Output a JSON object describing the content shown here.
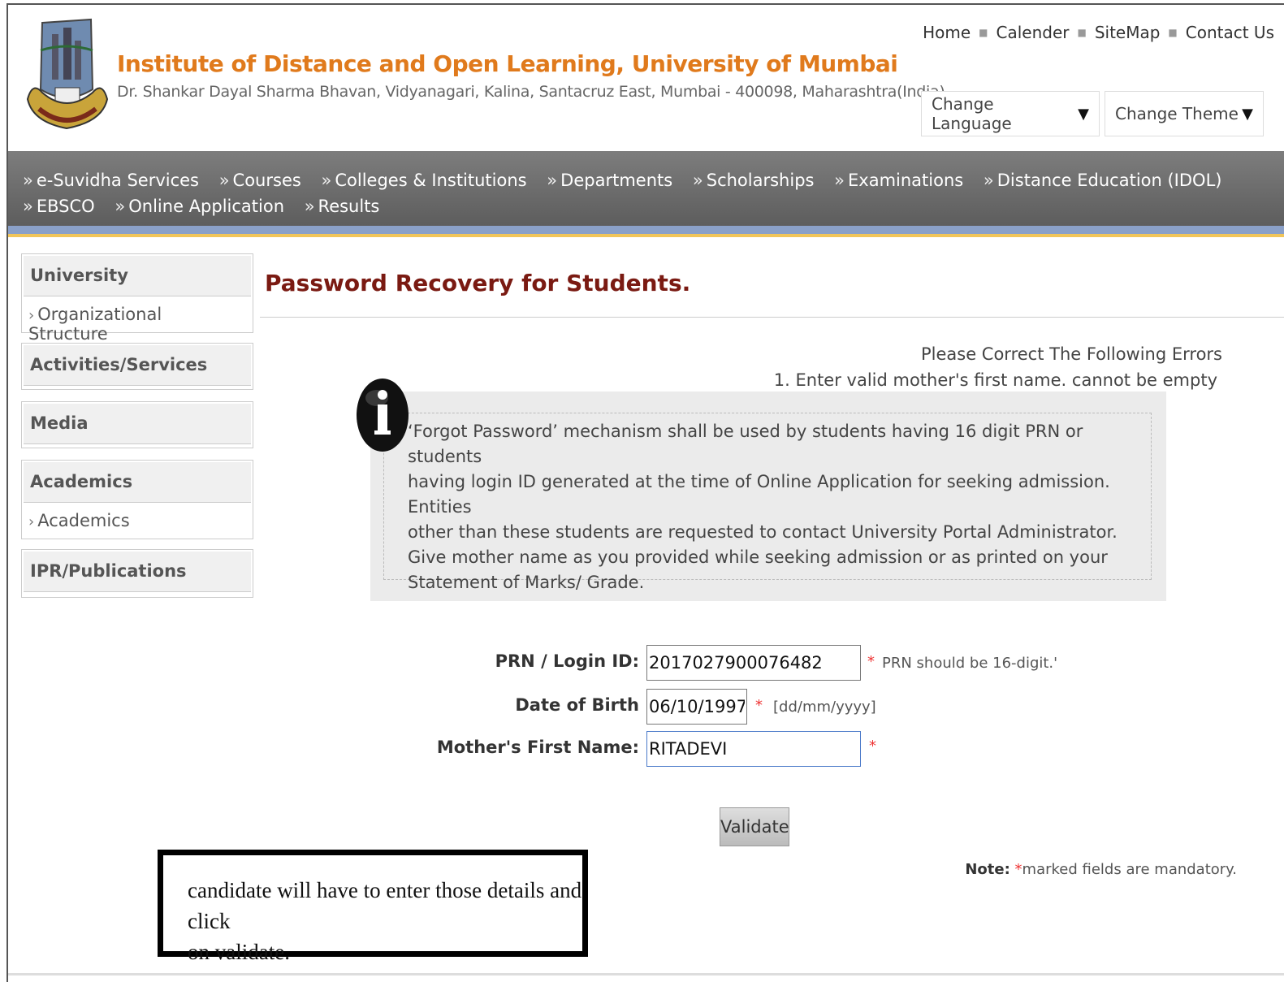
{
  "header": {
    "title": "Institute of Distance and Open Learning, University of Mumbai",
    "address": "Dr. Shankar Dayal Sharma Bhavan, Vidyanagari, Kalina, Santacruz East, Mumbai - 400098, Maharashtra(India)",
    "top_links": [
      "Home",
      "Calender",
      "SiteMap",
      "Contact Us"
    ],
    "language_select": "Change Language",
    "theme_select": "Change Theme"
  },
  "nav": {
    "items": [
      "e-Suvidha Services",
      "Courses",
      "Colleges & Institutions",
      "Departments",
      "Scholarships",
      "Examinations",
      "Distance Education (IDOL)",
      "EBSCO",
      "Online Application",
      "Results"
    ]
  },
  "sidebar": {
    "sections": [
      {
        "heading": "University",
        "items": [
          "Organizational Structure"
        ]
      },
      {
        "heading": "Activities/Services",
        "items": []
      },
      {
        "heading": "Media",
        "items": []
      },
      {
        "heading": "Academics",
        "items": [
          "Academics"
        ]
      },
      {
        "heading": "IPR/Publications",
        "items": []
      }
    ]
  },
  "main": {
    "page_title": "Password Recovery for Students.",
    "errors": {
      "heading": "Please Correct The Following Errors",
      "items": [
        "1. Enter valid mother's first name. cannot be empty"
      ]
    },
    "info_lines": [
      "‘Forgot Password’ mechanism shall be used by students having 16 digit PRN or students",
      "having login ID generated at the time of Online Application for seeking admission. Entities",
      "other than these students are requested to contact University Portal Administrator.",
      "Give mother name as you provided while seeking admission or as printed on your",
      "Statement of Marks/ Grade."
    ],
    "form": {
      "prn_label": "PRN / Login ID:",
      "prn_value": "2017027900076482",
      "prn_hint": "PRN should be 16-digit.'",
      "dob_label": "Date of Birth",
      "dob_value": "06/10/1997",
      "dob_hint": "[dd/mm/yyyy]",
      "mother_label": "Mother's First Name:",
      "mother_value": "RITADEVI",
      "required_mark": "*",
      "validate_label": "Validate"
    },
    "note_label": "Note:",
    "note_text": "marked fields are mandatory."
  },
  "callout": {
    "line1": "candidate will have to enter those details and click",
    "line2": "on validate."
  },
  "colors": {
    "title_orange": "#e07a1c",
    "page_title_maroon": "#7a1a12",
    "nav_gray": "#6b6b6b",
    "required_red": "#e33333"
  }
}
